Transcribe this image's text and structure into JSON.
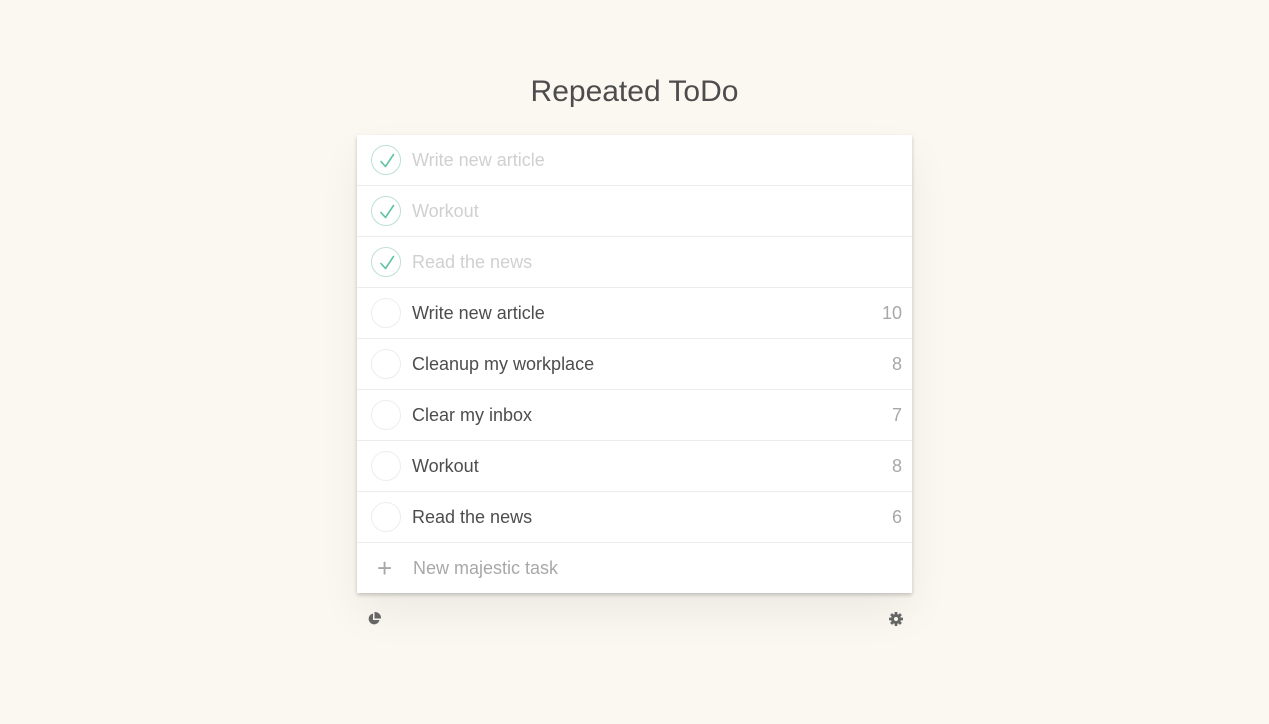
{
  "app": {
    "title": "Repeated ToDo"
  },
  "tasks": [
    {
      "label": "Write new article",
      "done": true,
      "count": ""
    },
    {
      "label": "Workout",
      "done": true,
      "count": ""
    },
    {
      "label": "Read the news",
      "done": true,
      "count": ""
    },
    {
      "label": "Write new article",
      "done": false,
      "count": "10"
    },
    {
      "label": "Cleanup my workplace",
      "done": false,
      "count": "8"
    },
    {
      "label": "Clear my inbox",
      "done": false,
      "count": "7"
    },
    {
      "label": "Workout",
      "done": false,
      "count": "8"
    },
    {
      "label": "Read the news",
      "done": false,
      "count": "6"
    }
  ],
  "new_task": {
    "placeholder": "New majestic task",
    "value": "",
    "icon": "plus-icon"
  },
  "footer": {
    "left_icon": "pie-chart-icon",
    "right_icon": "gear-icon"
  },
  "colors": {
    "background": "#fbf8f1",
    "check_accent": "#5fc2a5",
    "text": "#4d4d4d",
    "muted_text": "#a8a8a8",
    "done_text": "#d0d0d0"
  }
}
